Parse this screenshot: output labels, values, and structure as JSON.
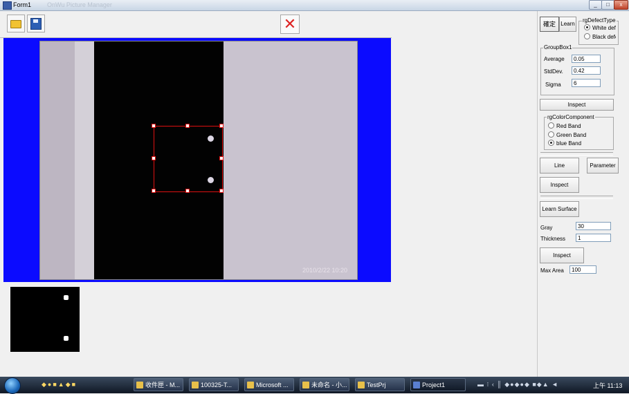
{
  "window": {
    "title": "Form1",
    "ghost_title": "OnWu Picture Manager",
    "controls": [
      "_",
      "□",
      "x"
    ]
  },
  "toolbar": {
    "open": "open-folder-icon",
    "save": "save-icon",
    "close": "✕"
  },
  "viewer": {
    "timestamp": "2010/2/22 10:20",
    "background_color": "#0b0bff"
  },
  "panel": {
    "tab_confirm": "確定",
    "tab_learn": "Learn",
    "defect_group": "rgDefectType",
    "defect_options": [
      "White defe",
      "Black defe"
    ],
    "groupbox1": "GroupBox1",
    "average_label": "Average",
    "average_value": "0.05",
    "stddev_label": "StdDev.",
    "stddev_value": "0.42",
    "sigma_label": "Sigma",
    "sigma_value": "6",
    "inspect1": "Inspect",
    "color_group": "rgColorComponent",
    "color_options": [
      "Red Band",
      "Green Band",
      "blue Band"
    ],
    "line_btn": "Line",
    "parameter_btn": "Parameter",
    "inspect2": "Inspect",
    "learn_surface": "Learn Surface",
    "gray_label": "Gray",
    "gray_value": "30",
    "thickness_label": "Thickness",
    "thickness_value": "1",
    "inspect3": "Inspect",
    "maxarea_label": "Max Area",
    "maxarea_value": "100"
  },
  "taskbar": {
    "tasks": [
      "收件匣 - M...",
      "100325-T...",
      "Microsoft ...",
      "未命名 - 小...",
      "TestPrj",
      "Project1"
    ],
    "clock": "上午 11:13"
  }
}
